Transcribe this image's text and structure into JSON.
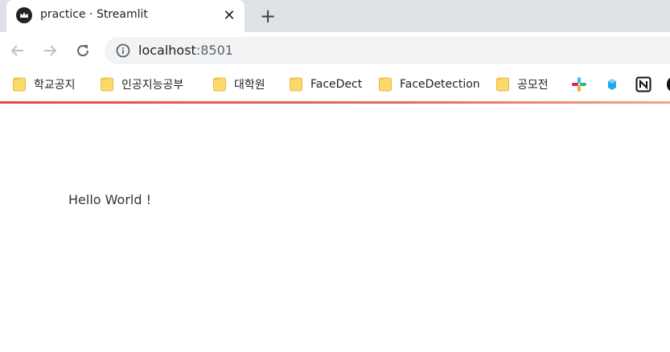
{
  "browser": {
    "tab": {
      "title": "practice · Streamlit",
      "close_glyph": "✕",
      "favicon": "streamlit-crown-icon"
    },
    "new_tab_glyph": "+",
    "address": {
      "host": "localhost",
      "port": ":8501"
    }
  },
  "bookmarks": {
    "items": [
      {
        "label": "학교공지"
      },
      {
        "label": "인공지능공부"
      },
      {
        "label": "대학원"
      },
      {
        "label": "FaceDect"
      },
      {
        "label": "FaceDetection"
      },
      {
        "label": "공모전"
      }
    ],
    "apps": [
      "slack-icon",
      "hexagon-app-icon",
      "notion-icon"
    ]
  },
  "colors": {
    "accent_line": "#e44b4b",
    "folder": "#fbd96a",
    "text": "#31333f"
  },
  "page": {
    "text": "Hello World !"
  }
}
